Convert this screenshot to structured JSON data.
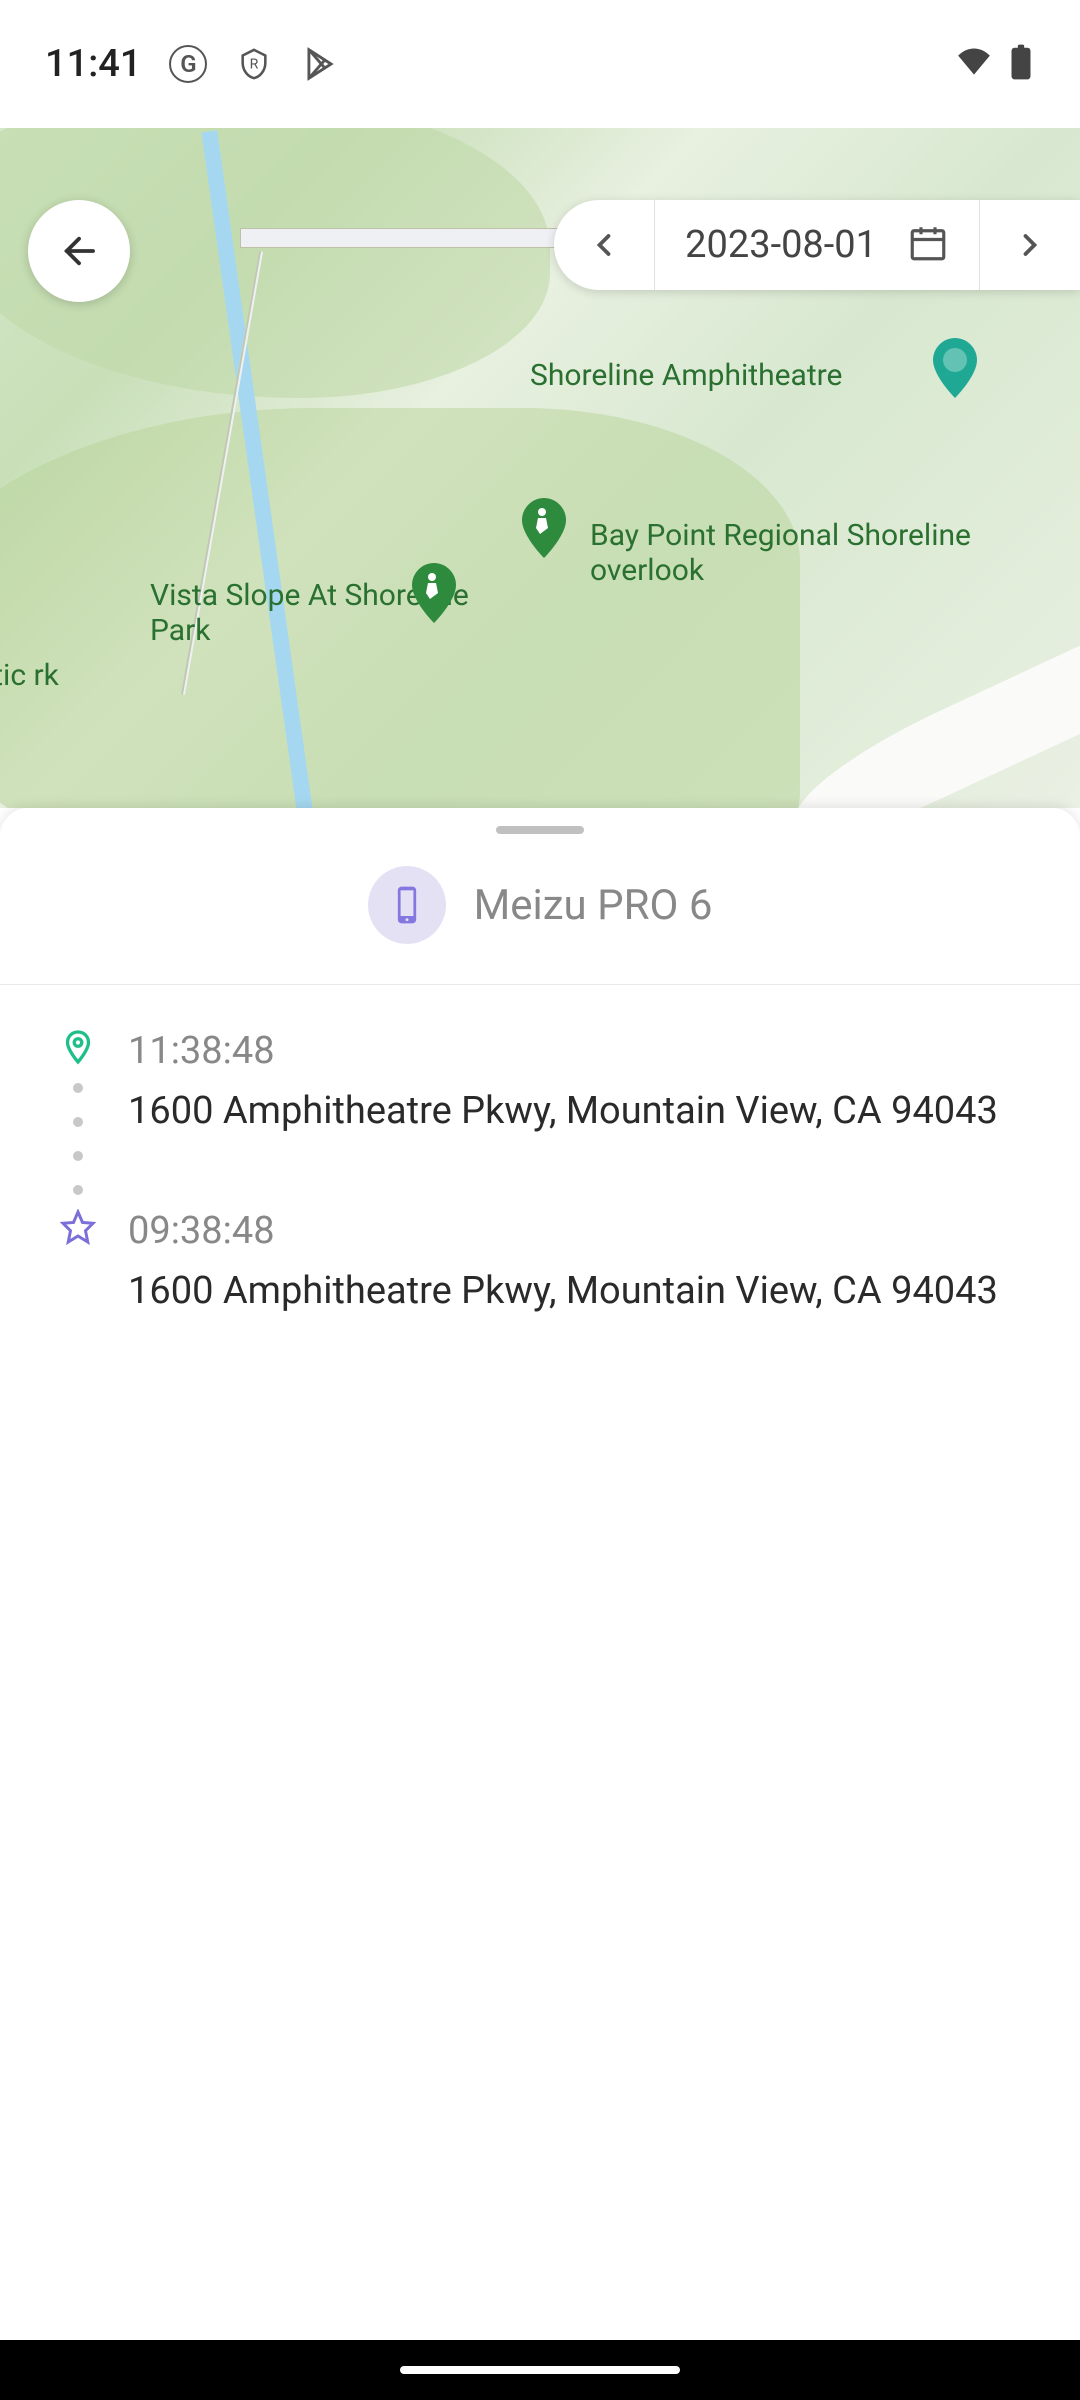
{
  "statusBar": {
    "time": "11:41"
  },
  "datePicker": {
    "date": "2023-08-01"
  },
  "mapLabels": {
    "amphitheatre": "Shoreline Amphitheatre",
    "baypoint": "Bay Point Regional Shoreline overlook",
    "vista": "Vista Slope At Shoreline Park",
    "athletic": "letic rk"
  },
  "device": {
    "name": "Meizu PRO 6"
  },
  "timeline": [
    {
      "time": "11:38:48",
      "address": "1600 Amphitheatre Pkwy, Mountain View, CA 94043",
      "iconType": "pin",
      "iconColor": "#1fbf8a"
    },
    {
      "time": "09:38:48",
      "address": "1600 Amphitheatre Pkwy, Mountain View, CA 94043",
      "iconType": "star",
      "iconColor": "#7b6fd9"
    }
  ],
  "colors": {
    "accent": "#7b6fd9",
    "green": "#1fbf8a",
    "mapGreen": "#2a7030"
  }
}
